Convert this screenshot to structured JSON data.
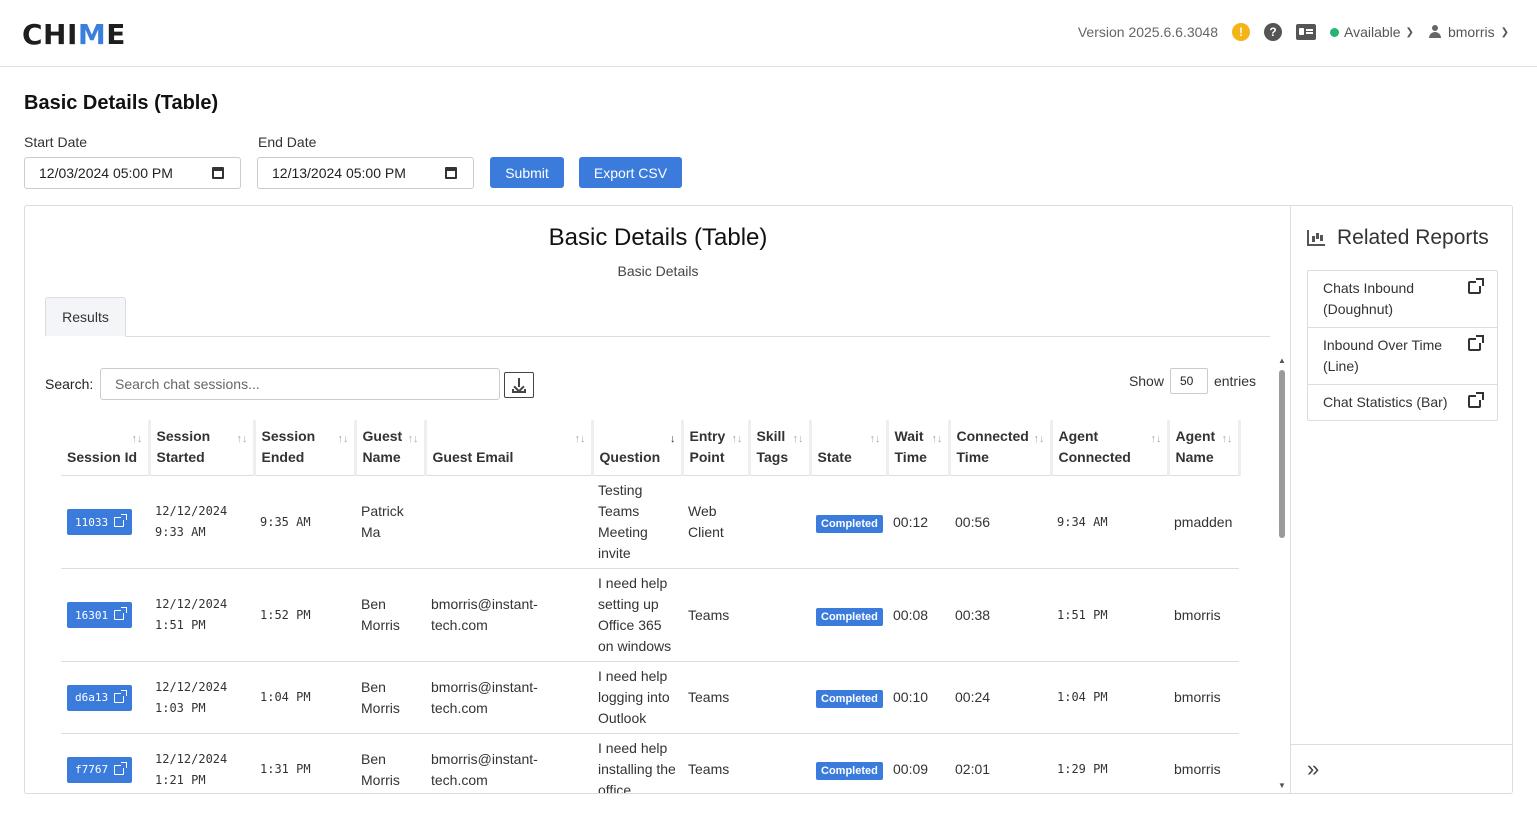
{
  "brand": {
    "logo_prefix": "CHI",
    "logo_accent": "M",
    "logo_suffix": "E"
  },
  "header": {
    "version": "Version 2025.6.6.3048",
    "alert_icon": "warning-icon",
    "help_icon": "help-icon",
    "card_icon": "id-card-icon",
    "status_label": "Available",
    "status_color": "#22b573",
    "username": "bmorris"
  },
  "page": {
    "title": "Basic Details (Table)",
    "start_label": "Start Date",
    "start_value": "12/03/2024 05:00  PM",
    "end_label": "End Date",
    "end_value": "12/13/2024 05:00  PM",
    "submit_label": "Submit",
    "export_label": "Export CSV"
  },
  "report": {
    "title": "Basic Details (Table)",
    "subtitle": "Basic Details",
    "tabs": [
      {
        "label": "Results"
      }
    ],
    "search_label": "Search:",
    "search_placeholder": "Search chat sessions...",
    "show_label": "Show",
    "show_value": "50",
    "entries_label": "entries"
  },
  "table": {
    "columns": [
      {
        "label": "Session Id"
      },
      {
        "label": "Session Started"
      },
      {
        "label": "Session Ended"
      },
      {
        "label": "Guest Name"
      },
      {
        "label": "Guest Email"
      },
      {
        "label": "Question"
      },
      {
        "label": "Entry Point"
      },
      {
        "label": "Skill Tags"
      },
      {
        "label": "State"
      },
      {
        "label": "Wait Time"
      },
      {
        "label": "Connected Time"
      },
      {
        "label": "Agent Connected"
      },
      {
        "label": "Agent Name"
      }
    ],
    "rows": [
      {
        "id": "11033",
        "started": "12/12/2024 9:33 AM",
        "ended": "9:35 AM",
        "guest": "Patrick Ma",
        "email": "",
        "question": "Testing Teams Meeting invite",
        "entry": "Web Client",
        "tags": "",
        "state": "Completed",
        "wait": "00:12",
        "connected": "00:56",
        "agent_connected": "9:34 AM",
        "agent": "pmadden"
      },
      {
        "id": "16301",
        "started": "12/12/2024 1:51 PM",
        "ended": "1:52 PM",
        "guest": "Ben Morris",
        "email": "bmorris@instant-tech.com",
        "question": "I need help setting up Office 365 on windows",
        "entry": "Teams",
        "tags": "",
        "state": "Completed",
        "wait": "00:08",
        "connected": "00:38",
        "agent_connected": "1:51 PM",
        "agent": "bmorris"
      },
      {
        "id": "d6a13",
        "started": "12/12/2024 1:03 PM",
        "ended": "1:04 PM",
        "guest": "Ben Morris",
        "email": "bmorris@instant-tech.com",
        "question": "I need help logging into Outlook",
        "entry": "Teams",
        "tags": "",
        "state": "Completed",
        "wait": "00:10",
        "connected": "00:24",
        "agent_connected": "1:04 PM",
        "agent": "bmorris"
      },
      {
        "id": "f7767",
        "started": "12/12/2024 1:21 PM",
        "ended": "1:31 PM",
        "guest": "Ben Morris",
        "email": "bmorris@instant-tech.com",
        "question": "I need help installing the office",
        "entry": "Teams",
        "tags": "",
        "state": "Completed",
        "wait": "00:09",
        "connected": "02:01",
        "agent_connected": "1:29 PM",
        "agent": "bmorris"
      }
    ]
  },
  "related": {
    "title": "Related Reports",
    "icon": "area-chart-icon",
    "items": [
      {
        "label": "Chats Inbound (Doughnut)"
      },
      {
        "label": "Inbound Over Time (Line)"
      },
      {
        "label": "Chat Statistics (Bar)"
      }
    ],
    "collapse_icon": "double-chevron-right-icon"
  },
  "colors": {
    "accent": "#3a7bdc",
    "logo_accent": "#3b7fde",
    "warning": "#f5b316"
  }
}
